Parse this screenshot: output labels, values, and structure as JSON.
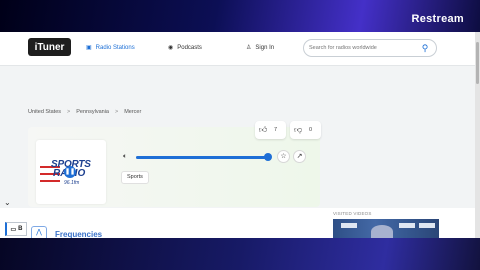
{
  "stream": {
    "brand": "Restream"
  },
  "header": {
    "logo": "iTuner",
    "nav": [
      {
        "label": "Radio Stations",
        "icon": "radio-icon",
        "active": true
      },
      {
        "label": "Podcasts",
        "icon": "podcast-icon",
        "active": false
      },
      {
        "label": "Sign In",
        "icon": "user-icon",
        "active": false
      }
    ],
    "search": {
      "placeholder": "Search for radios worldwide",
      "icon": "search-icon"
    }
  },
  "breadcrumb": [
    "United States",
    "Pennsylvania",
    "Mercer"
  ],
  "votes": {
    "up": "7",
    "down": "0"
  },
  "station": {
    "logo_text": {
      "line1": "SPORTS",
      "line2": "RADIO",
      "freq": "96.1fm"
    },
    "genre": "Sports",
    "volume": 1.0
  },
  "tab_label": "B",
  "section_heading": "Frequencies",
  "visited_label": "VISITED VIDEOS",
  "colors": {
    "accent": "#1e6fd6",
    "page_bg": "#f2f4f5"
  }
}
